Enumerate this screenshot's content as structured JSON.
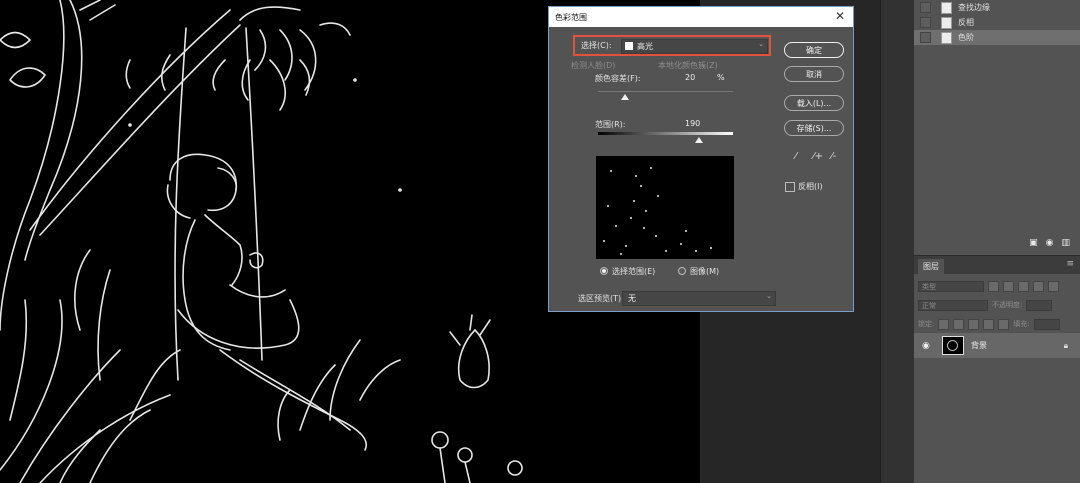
{
  "dialog": {
    "title": "色彩范围",
    "close_glyph": "✕",
    "select_label": "选择(C):",
    "select_value": "高光",
    "detect_faces_label": "检测人脸(D)",
    "localized_label": "本地化颜色簇(Z)",
    "fuzziness_label": "颜色容差(F):",
    "fuzziness_value": "20",
    "fuzziness_unit": "%",
    "range_label": "范围(R):",
    "range_value": "190",
    "radio_selection": "选择范围(E)",
    "radio_image": "图像(M)",
    "selection_preview_label": "选区预览(T):",
    "selection_preview_value": "无",
    "ok_label": "确定",
    "cancel_label": "取消",
    "load_label": "载入(L)...",
    "save_label": "存储(S)...",
    "invert_label": "反相(I)",
    "eyedropper_icons": [
      "eyedropper-icon",
      "eyedropper-plus-icon",
      "eyedropper-minus-icon"
    ],
    "highlight_color": "#e0533d"
  },
  "history": {
    "items": [
      {
        "label": "查找边缘"
      },
      {
        "label": "反相"
      },
      {
        "label": "色阶",
        "selected": true
      }
    ]
  },
  "layers": {
    "tab_label": "图层",
    "filter_placeholder": "类型",
    "blend_mode": "正常",
    "opacity_label": "不透明度:",
    "lock_label": "锁定:",
    "fill_label": "填充:",
    "layer": {
      "name": "背景"
    }
  }
}
